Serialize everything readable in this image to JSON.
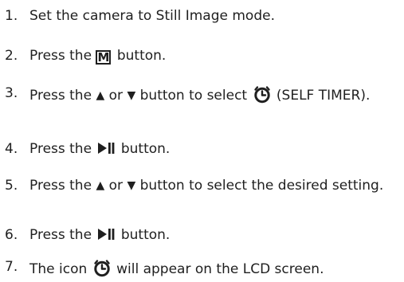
{
  "steps": [
    {
      "num": "1.",
      "text": "Set the camera to Still Image mode."
    },
    {
      "num": "2.",
      "pre": "Press the",
      "post": "button.",
      "icon_label": "M",
      "icon": "menu-button-icon"
    },
    {
      "num": "3.",
      "pre": "Press the",
      "mid": "or",
      "post": "button to select",
      "tail": "(SELF TIMER).",
      "icon_up": "up-triangle-icon",
      "icon_down": "down-triangle-icon",
      "icon_timer": "self-timer-icon",
      "glyph_up": "▲",
      "glyph_down": "▼"
    },
    {
      "num": "4.",
      "pre": "Press the",
      "post": "button.",
      "icon": "play-pause-icon"
    },
    {
      "num": "5.",
      "pre": "Press the",
      "mid": "or",
      "post": "button to select the desired setting.",
      "icon_up": "up-triangle-icon",
      "icon_down": "down-triangle-icon",
      "glyph_up": "▲",
      "glyph_down": "▼"
    },
    {
      "num": "6.",
      "pre": "Press the",
      "post": "button.",
      "icon": "play-pause-icon"
    },
    {
      "num": "7.",
      "pre": "The icon",
      "post": "will appear on the LCD screen.",
      "icon": "self-timer-icon"
    }
  ],
  "colors": {
    "text": "#1f1f1f",
    "background": "#ffffff"
  }
}
